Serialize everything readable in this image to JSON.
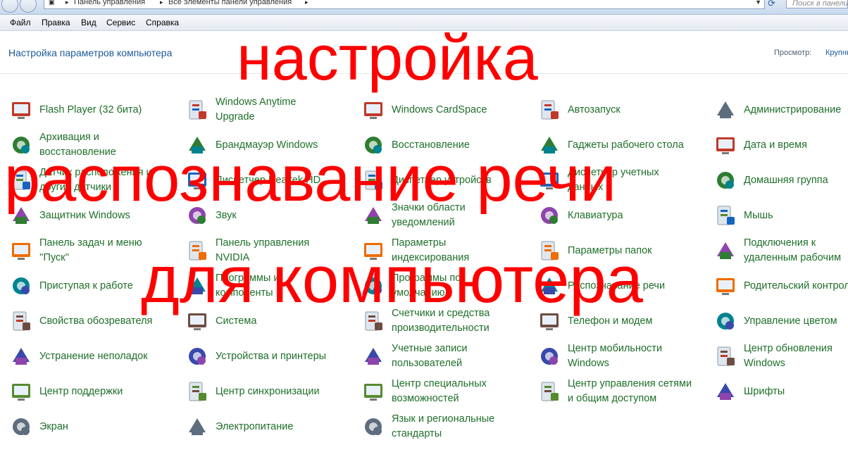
{
  "address_bar": {
    "crumbs": [
      "Панель управления",
      "Все элементы панели управления"
    ],
    "search_placeholder": "Поиск в панели"
  },
  "menu": [
    "Файл",
    "Правка",
    "Вид",
    "Сервис",
    "Справка"
  ],
  "header": {
    "title": "Настройка параметров компьютера",
    "view_label": "Просмотр:",
    "view_value": "Крупные значки"
  },
  "columns": [
    [
      {
        "label": "Flash Player (32 бита)",
        "icon": "flash-icon"
      },
      {
        "label": "Архивация и\nвосстановление",
        "icon": "backup-icon"
      },
      {
        "label": "Датчик расположения и\nдругие датчики",
        "icon": "sensor-icon"
      },
      {
        "label": "Защитник Windows",
        "icon": "defender-icon"
      },
      {
        "label": "Панель задач и меню\n''Пуск''",
        "icon": "taskbar-icon"
      },
      {
        "label": "Приступая к работе",
        "icon": "getting-started-icon"
      },
      {
        "label": "Свойства обозревателя",
        "icon": "internet-options-icon"
      },
      {
        "label": "Устранение неполадок",
        "icon": "troubleshoot-icon"
      },
      {
        "label": "Центр поддержки",
        "icon": "flag-icon"
      },
      {
        "label": "Экран",
        "icon": "display-icon"
      }
    ],
    [
      {
        "label": "Windows Anytime\nUpgrade",
        "icon": "windows-logo-icon"
      },
      {
        "label": "Брандмауэр Windows",
        "icon": "firewall-icon"
      },
      {
        "label": "Диспетчер Realtek HD",
        "icon": "realtek-icon"
      },
      {
        "label": "Звук",
        "icon": "speaker-icon"
      },
      {
        "label": "Панель управления\nNVIDIA",
        "icon": "nvidia-icon"
      },
      {
        "label": "Программы и\nкомпоненты",
        "icon": "programs-icon"
      },
      {
        "label": "Система",
        "icon": "system-icon"
      },
      {
        "label": "Устройства и принтеры",
        "icon": "printer-icon"
      },
      {
        "label": "Центр синхронизации",
        "icon": "sync-icon"
      },
      {
        "label": "Электропитание",
        "icon": "power-icon"
      }
    ],
    [
      {
        "label": "Windows CardSpace",
        "icon": "cardspace-icon"
      },
      {
        "label": "Восстановление",
        "icon": "recovery-icon"
      },
      {
        "label": "Диспетчер устройств",
        "icon": "device-manager-icon"
      },
      {
        "label": "Значки области\nуведомлений",
        "icon": "notification-icons-icon"
      },
      {
        "label": "Параметры\nиндексирования",
        "icon": "indexing-icon"
      },
      {
        "label": "Программы по\nумолчанию",
        "icon": "default-programs-icon"
      },
      {
        "label": "Счетчики и средства\nпроизводительности",
        "icon": "performance-icon"
      },
      {
        "label": "Учетные записи\nпользователей",
        "icon": "users-icon"
      },
      {
        "label": "Центр специальных\nвозможностей",
        "icon": "accessibility-icon"
      },
      {
        "label": "Язык и региональные\nстандарты",
        "icon": "globe-icon"
      }
    ],
    [
      {
        "label": "Автозапуск",
        "icon": "autoplay-icon"
      },
      {
        "label": "Гаджеты рабочего стола",
        "icon": "gadgets-icon"
      },
      {
        "label": "Диспетчер учетных\nданных",
        "icon": "credential-icon"
      },
      {
        "label": "Клавиатура",
        "icon": "keyboard-icon"
      },
      {
        "label": "Параметры папок",
        "icon": "folder-icon"
      },
      {
        "label": "Распознавание речи",
        "icon": "microphone-icon"
      },
      {
        "label": "Телефон и модем",
        "icon": "phone-icon"
      },
      {
        "label": "Центр мобильности\nWindows",
        "icon": "mobility-icon"
      },
      {
        "label": "Центр управления сетями\nи общим доступом",
        "icon": "network-icon"
      }
    ],
    [
      {
        "label": "Администрирование",
        "icon": "admin-tools-icon"
      },
      {
        "label": "Дата и время",
        "icon": "calendar-clock-icon"
      },
      {
        "label": "Домашняя группа",
        "icon": "homegroup-icon"
      },
      {
        "label": "Мышь",
        "icon": "mouse-icon"
      },
      {
        "label": "Подключения к\nудаленным рабочим",
        "icon": "remote-desktop-icon"
      },
      {
        "label": "Родительский контроль",
        "icon": "parental-control-icon"
      },
      {
        "label": "Управление цветом",
        "icon": "color-management-icon"
      },
      {
        "label": "Центр обновления\nWindows",
        "icon": "windows-update-icon"
      },
      {
        "label": "Шрифты",
        "icon": "fonts-icon"
      }
    ]
  ],
  "overlay": {
    "line1": "настройка",
    "line2": "распознавание речи",
    "line3": "для компьютера"
  },
  "colors": {
    "link_green": "#1f6f2a",
    "title_blue": "#1c5a9a",
    "overlay_red": "#ff0000"
  }
}
